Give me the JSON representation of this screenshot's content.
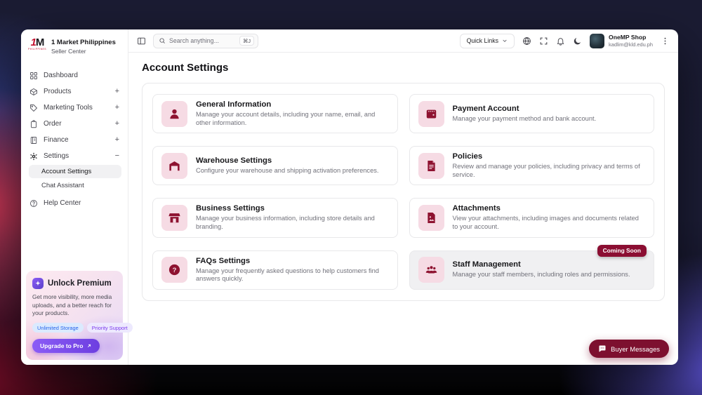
{
  "brand": {
    "logo_main_1": "1",
    "logo_main_2": "M",
    "logo_caption": "PHILIPPINES",
    "name": "1 Market Philippines",
    "subtitle": "Seller Center"
  },
  "sidebar": {
    "items": [
      {
        "label": "Dashboard"
      },
      {
        "label": "Products",
        "expander": "+"
      },
      {
        "label": "Marketing Tools",
        "expander": "+"
      },
      {
        "label": "Order",
        "expander": "+"
      },
      {
        "label": "Finance",
        "expander": "+"
      },
      {
        "label": "Settings",
        "expander": "−"
      }
    ],
    "subitems": [
      {
        "label": "Account Settings"
      },
      {
        "label": "Chat Assistant"
      }
    ],
    "help_label": "Help Center"
  },
  "premium": {
    "title": "Unlock Premium",
    "description": "Get more visibility, more media uploads, and a better reach for your products.",
    "badges": [
      "Unlimited Storage",
      "Priority Support"
    ],
    "cta_label": "Upgrade to Pro"
  },
  "topbar": {
    "search_placeholder": "Search anything...",
    "shortcut": "⌘J",
    "quick_links_label": "Quick Links",
    "user_name": "OneMP Shop",
    "user_email": "kadlim@kld.edu.ph"
  },
  "main": {
    "page_title": "Account Settings",
    "coming_soon_label": "Coming Soon",
    "cards": [
      {
        "title": "General Information",
        "description": "Manage your account details, including your name, email, and other information."
      },
      {
        "title": "Payment Account",
        "description": "Manage your payment method and bank account."
      },
      {
        "title": "Warehouse Settings",
        "description": "Configure your warehouse and shipping activation preferences."
      },
      {
        "title": "Policies",
        "description": "Review and manage your policies, including privacy and terms of service."
      },
      {
        "title": "Business Settings",
        "description": "Manage your business information, including store details and branding."
      },
      {
        "title": "Attachments",
        "description": "View your attachments, including images and documents related to your account."
      },
      {
        "title": "FAQs Settings",
        "description": "Manage your frequently asked questions to help customers find answers quickly."
      },
      {
        "title": "Staff Management",
        "description": "Manage your staff members, including roles and permissions."
      }
    ]
  },
  "floating": {
    "buyer_messages_label": "Buyer Messages"
  },
  "colors": {
    "primary_maroon": "#8B0E32",
    "icon_tile_bg": "#F6DBE4",
    "icon_tile_fg": "#8E1230",
    "accent_purple": "#7C3AED",
    "badge_blue": "#2563EB"
  }
}
